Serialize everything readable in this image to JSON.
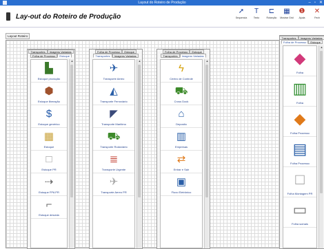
{
  "window": {
    "title": "Layout do Roteiro de Produção"
  },
  "header": {
    "title": "Lay-out do Roteiro de Produção"
  },
  "toolbar": [
    {
      "label": "Sequencia",
      "icon": "arrow-icon",
      "glyph": "➚"
    },
    {
      "label": "Texto",
      "icon": "text-icon",
      "glyph": "T"
    },
    {
      "label": "Rotanção",
      "icon": "rotate-icon",
      "glyph": "⊏"
    },
    {
      "label": "Mostrar Grid",
      "icon": "grid-icon",
      "glyph": "▦"
    },
    {
      "label": "Ajuda",
      "icon": "help-icon",
      "glyph": "❶"
    },
    {
      "label": "Fech",
      "icon": "close-icon",
      "glyph": "✕"
    }
  ],
  "mode_tab": "Layout Roteiro",
  "panels": [
    {
      "tabs_row1": [
        "Transportes",
        "Imagens Variadas"
      ],
      "tabs_row2": [
        "Folha de Processo",
        "Estoque"
      ],
      "selected": "Estoque",
      "items": [
        {
          "label": "Estoque produção",
          "glyph": "▙",
          "color": "#3b7a2a"
        },
        {
          "label": "Estoque liberação",
          "glyph": "⬢",
          "color": "#a0522d"
        },
        {
          "label": "Estoque genérico",
          "glyph": "$",
          "color": "#1f57a8"
        },
        {
          "label": "Estoque",
          "glyph": "▦",
          "color": "#c9a23a"
        },
        {
          "label": "Estoque PR",
          "glyph": "□",
          "color": "#999999"
        },
        {
          "label": "Estoque FPA PR",
          "glyph": "⇢",
          "color": "#666666"
        },
        {
          "label": "Estoque descida",
          "glyph": "⌐",
          "color": "#666666"
        }
      ]
    },
    {
      "tabs_row1": [
        "Folha de Processo",
        "Estoque"
      ],
      "tabs_row2": [
        "Transportes",
        "Imagens Variadas"
      ],
      "selected": "Transportes",
      "items": [
        {
          "label": "Transporte Aereo",
          "glyph": "✈",
          "color": "#2a5fa8"
        },
        {
          "label": "Transporte Ferroviário",
          "glyph": "◭",
          "color": "#2a5fa8"
        },
        {
          "label": "Transporte Marítimo",
          "glyph": "◤",
          "color": "#3a4a7a"
        },
        {
          "label": "Transporte Rodoviário",
          "glyph": "⛟",
          "color": "#3d8a2a"
        },
        {
          "label": "Transporte Urgente",
          "glyph": "≣",
          "color": "#c0392b"
        },
        {
          "label": "Transporte Aereo PR",
          "glyph": "✈",
          "color": "#aaaaaa"
        }
      ]
    },
    {
      "tabs_row1": [
        "Folha de Processo",
        "Estoque"
      ],
      "tabs_row2": [
        "Transportes",
        "Imagens Variadas"
      ],
      "selected": "Imagens Variadas",
      "items": [
        {
          "label": "Centro de Controle",
          "glyph": "ϟ",
          "color": "#d4a00a"
        },
        {
          "label": "Cross Dock",
          "glyph": "⛟",
          "color": "#3d8a2a"
        },
        {
          "label": "Deposito",
          "glyph": "⌂",
          "color": "#2a5fa8"
        },
        {
          "label": "Empresas",
          "glyph": "▥",
          "color": "#2a5fa8"
        },
        {
          "label": "Entrar e Sair",
          "glyph": "⇄",
          "color": "#e07a1a"
        },
        {
          "label": "Fluxo Eletrônico",
          "glyph": "▣",
          "color": "#2a5fa8"
        }
      ]
    },
    {
      "tabs_row1": [
        "Transportes",
        "Imagens Variadas"
      ],
      "tabs_row2": [
        "Folha de Processo",
        "Estoque"
      ],
      "selected": "Folha de Processo",
      "items": [
        {
          "label": "Folha",
          "glyph": "◆",
          "color": "#d23a7a"
        },
        {
          "label": "Folha",
          "glyph": "▥",
          "color": "#2a8a2a"
        },
        {
          "label": "Folha Processo",
          "glyph": "◆",
          "color": "#e07a1a"
        },
        {
          "label": "Folha Processo",
          "glyph": "▤",
          "color": "#2a5fa8"
        },
        {
          "label": "Folha Montagem PR",
          "glyph": "□",
          "color": "#999999"
        },
        {
          "label": "Folha somais",
          "glyph": "▭",
          "color": "#777777"
        }
      ]
    }
  ]
}
